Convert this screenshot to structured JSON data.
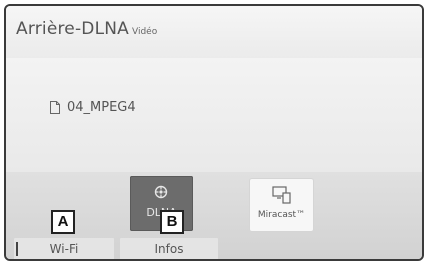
{
  "header": {
    "title": "Arrière-DLNA",
    "subtitle": "Vidéo"
  },
  "file_list": {
    "items": [
      {
        "name": "04_MPEG4",
        "icon": "file-icon"
      }
    ]
  },
  "sources": {
    "dlna": {
      "label": "DLNA",
      "icon": "dlna-icon",
      "selected": true
    },
    "miracast": {
      "label": "Miracast™",
      "icon": "miracast-icon",
      "selected": false
    }
  },
  "callouts": {
    "a": "A",
    "b": "B"
  },
  "tabs": {
    "wifi_label": "Wi-Fi",
    "infos_label": "Infos"
  }
}
